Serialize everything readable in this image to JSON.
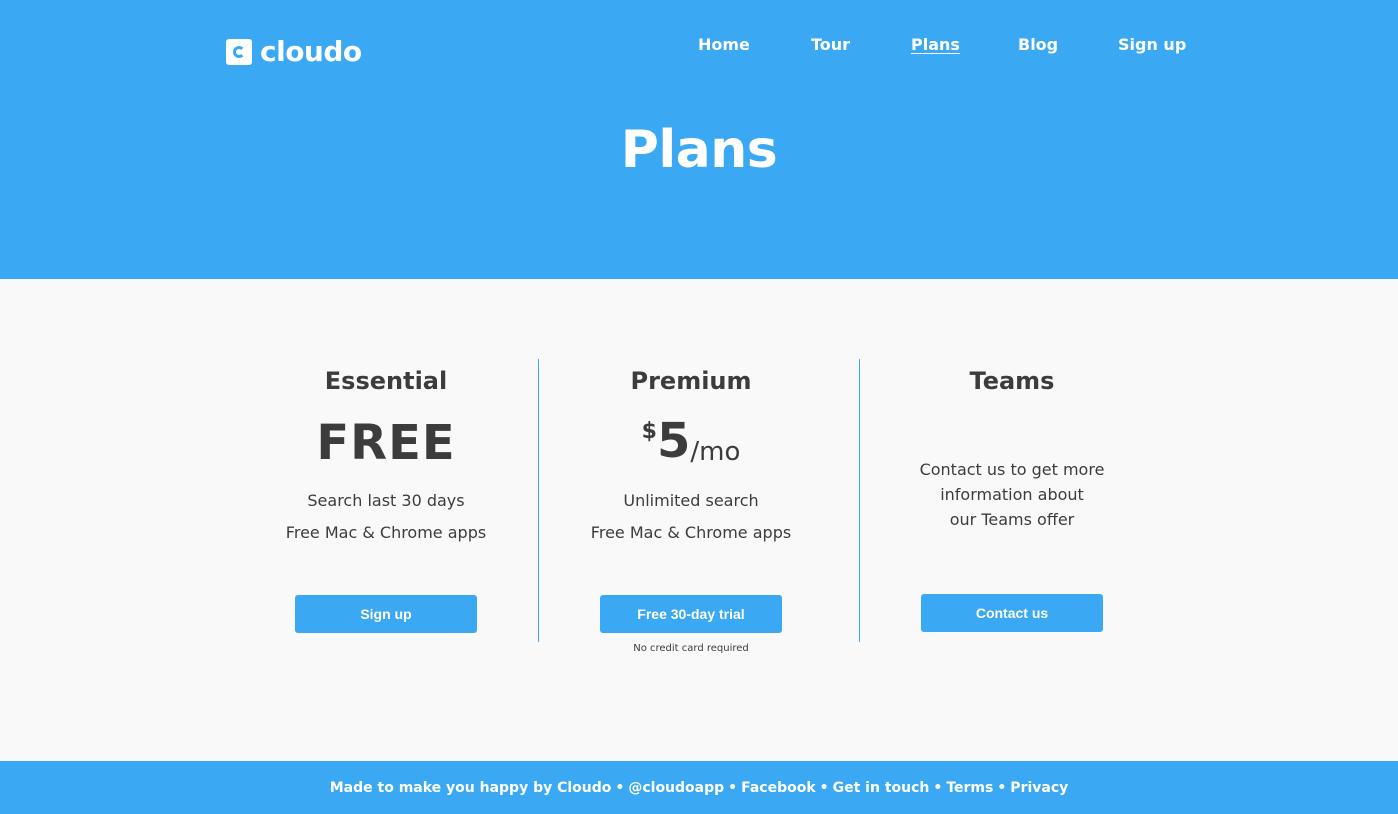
{
  "brand": {
    "name": "cloudo"
  },
  "nav": [
    {
      "label": "Home",
      "active": false
    },
    {
      "label": "Tour",
      "active": false
    },
    {
      "label": "Plans",
      "active": true
    },
    {
      "label": "Blog",
      "active": false
    },
    {
      "label": "Sign up",
      "active": false
    }
  ],
  "hero": {
    "title": "Plans"
  },
  "plans": {
    "essential": {
      "name": "Essential",
      "price": "FREE",
      "features": [
        "Search last 30 days",
        "Free Mac & Chrome apps"
      ],
      "cta": "Sign up"
    },
    "premium": {
      "name": "Premium",
      "currency": "$",
      "amount": "5",
      "period": "/mo",
      "features": [
        "Unlimited search",
        "Free Mac & Chrome apps"
      ],
      "cta": "Free 30-day trial",
      "note": "No credit card required"
    },
    "teams": {
      "name": "Teams",
      "info": [
        "Contact us to get more",
        "information about",
        "our Teams offer"
      ],
      "cta": "Contact us"
    }
  },
  "footer": {
    "made_by": "Made to make you happy by Cloudo",
    "twitter": "@cloudoapp",
    "facebook": "Facebook",
    "contact": "Get in touch",
    "terms": "Terms",
    "privacy": "Privacy",
    "separator": "•"
  },
  "colors": {
    "brand_blue": "#3ba8f3",
    "text_dark": "#3c3c3c",
    "background": "#f9f9f9"
  }
}
